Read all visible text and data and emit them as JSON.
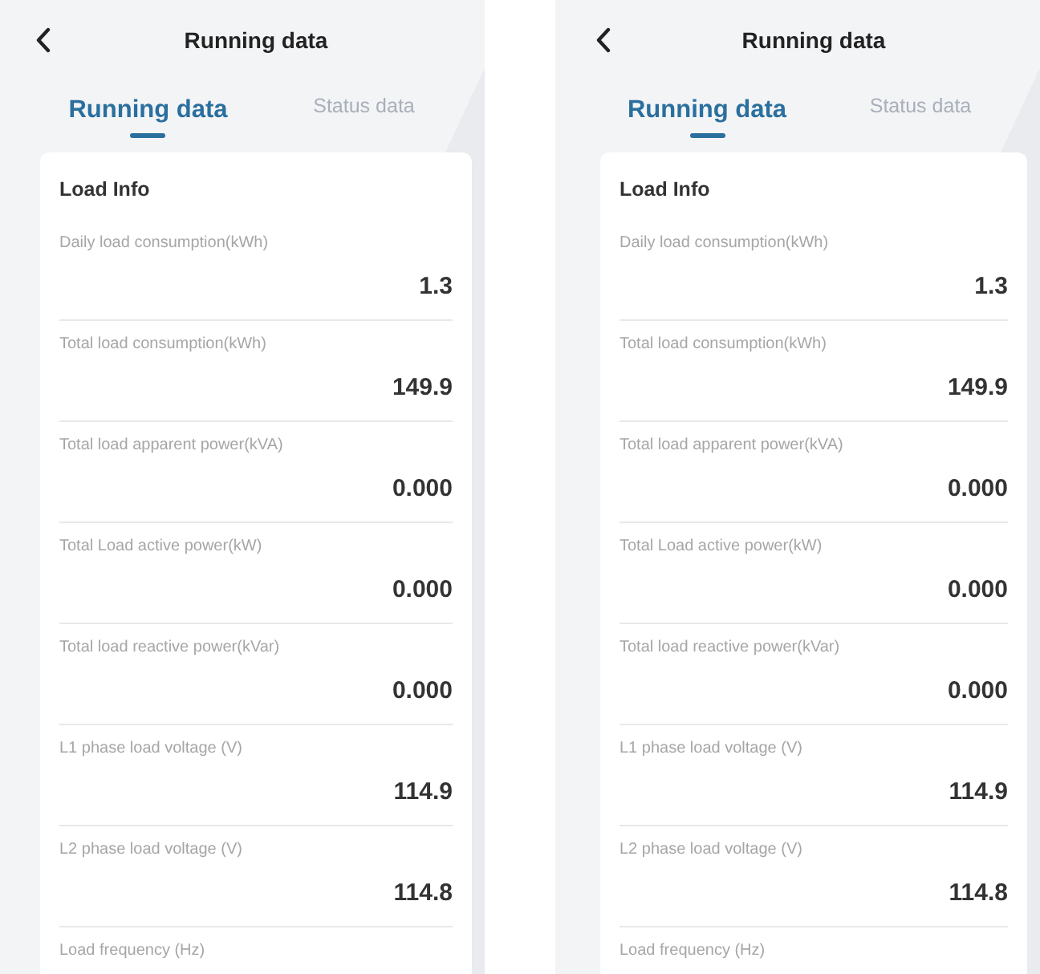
{
  "screens": [
    {
      "title": "Running data",
      "tabs": [
        {
          "label": "Running data",
          "selected": true
        },
        {
          "label": "Status data",
          "selected": false
        }
      ],
      "section": "Load Info",
      "rows": [
        {
          "label": "Daily load consumption(kWh)",
          "value": "1.3"
        },
        {
          "label": "Total load consumption(kWh)",
          "value": "149.9"
        },
        {
          "label": "Total load apparent power(kVA)",
          "value": "0.000"
        },
        {
          "label": "Total Load active power(kW)",
          "value": "0.000"
        },
        {
          "label": "Total load reactive power(kVar)",
          "value": "0.000"
        },
        {
          "label": "L1 phase load voltage (V)",
          "value": "114.9"
        },
        {
          "label": "L2 phase load voltage (V)",
          "value": "114.8"
        },
        {
          "label": "Load frequency (Hz)"
        }
      ]
    },
    {
      "title": "Running data",
      "tabs": [
        {
          "label": "Running data",
          "selected": true
        },
        {
          "label": "Status data",
          "selected": false
        }
      ],
      "section": "Load Info",
      "rows": [
        {
          "label": "Daily load consumption(kWh)",
          "value": "1.3"
        },
        {
          "label": "Total load consumption(kWh)",
          "value": "149.9"
        },
        {
          "label": "Total load apparent power(kVA)",
          "value": "0.000"
        },
        {
          "label": "Total Load active power(kW)",
          "value": "0.000"
        },
        {
          "label": "Total load reactive power(kVar)",
          "value": "0.000"
        },
        {
          "label": "L1 phase load voltage (V)",
          "value": "114.9"
        },
        {
          "label": "L2 phase load voltage (V)",
          "value": "114.8"
        },
        {
          "label": "Load frequency (Hz)"
        }
      ]
    }
  ]
}
